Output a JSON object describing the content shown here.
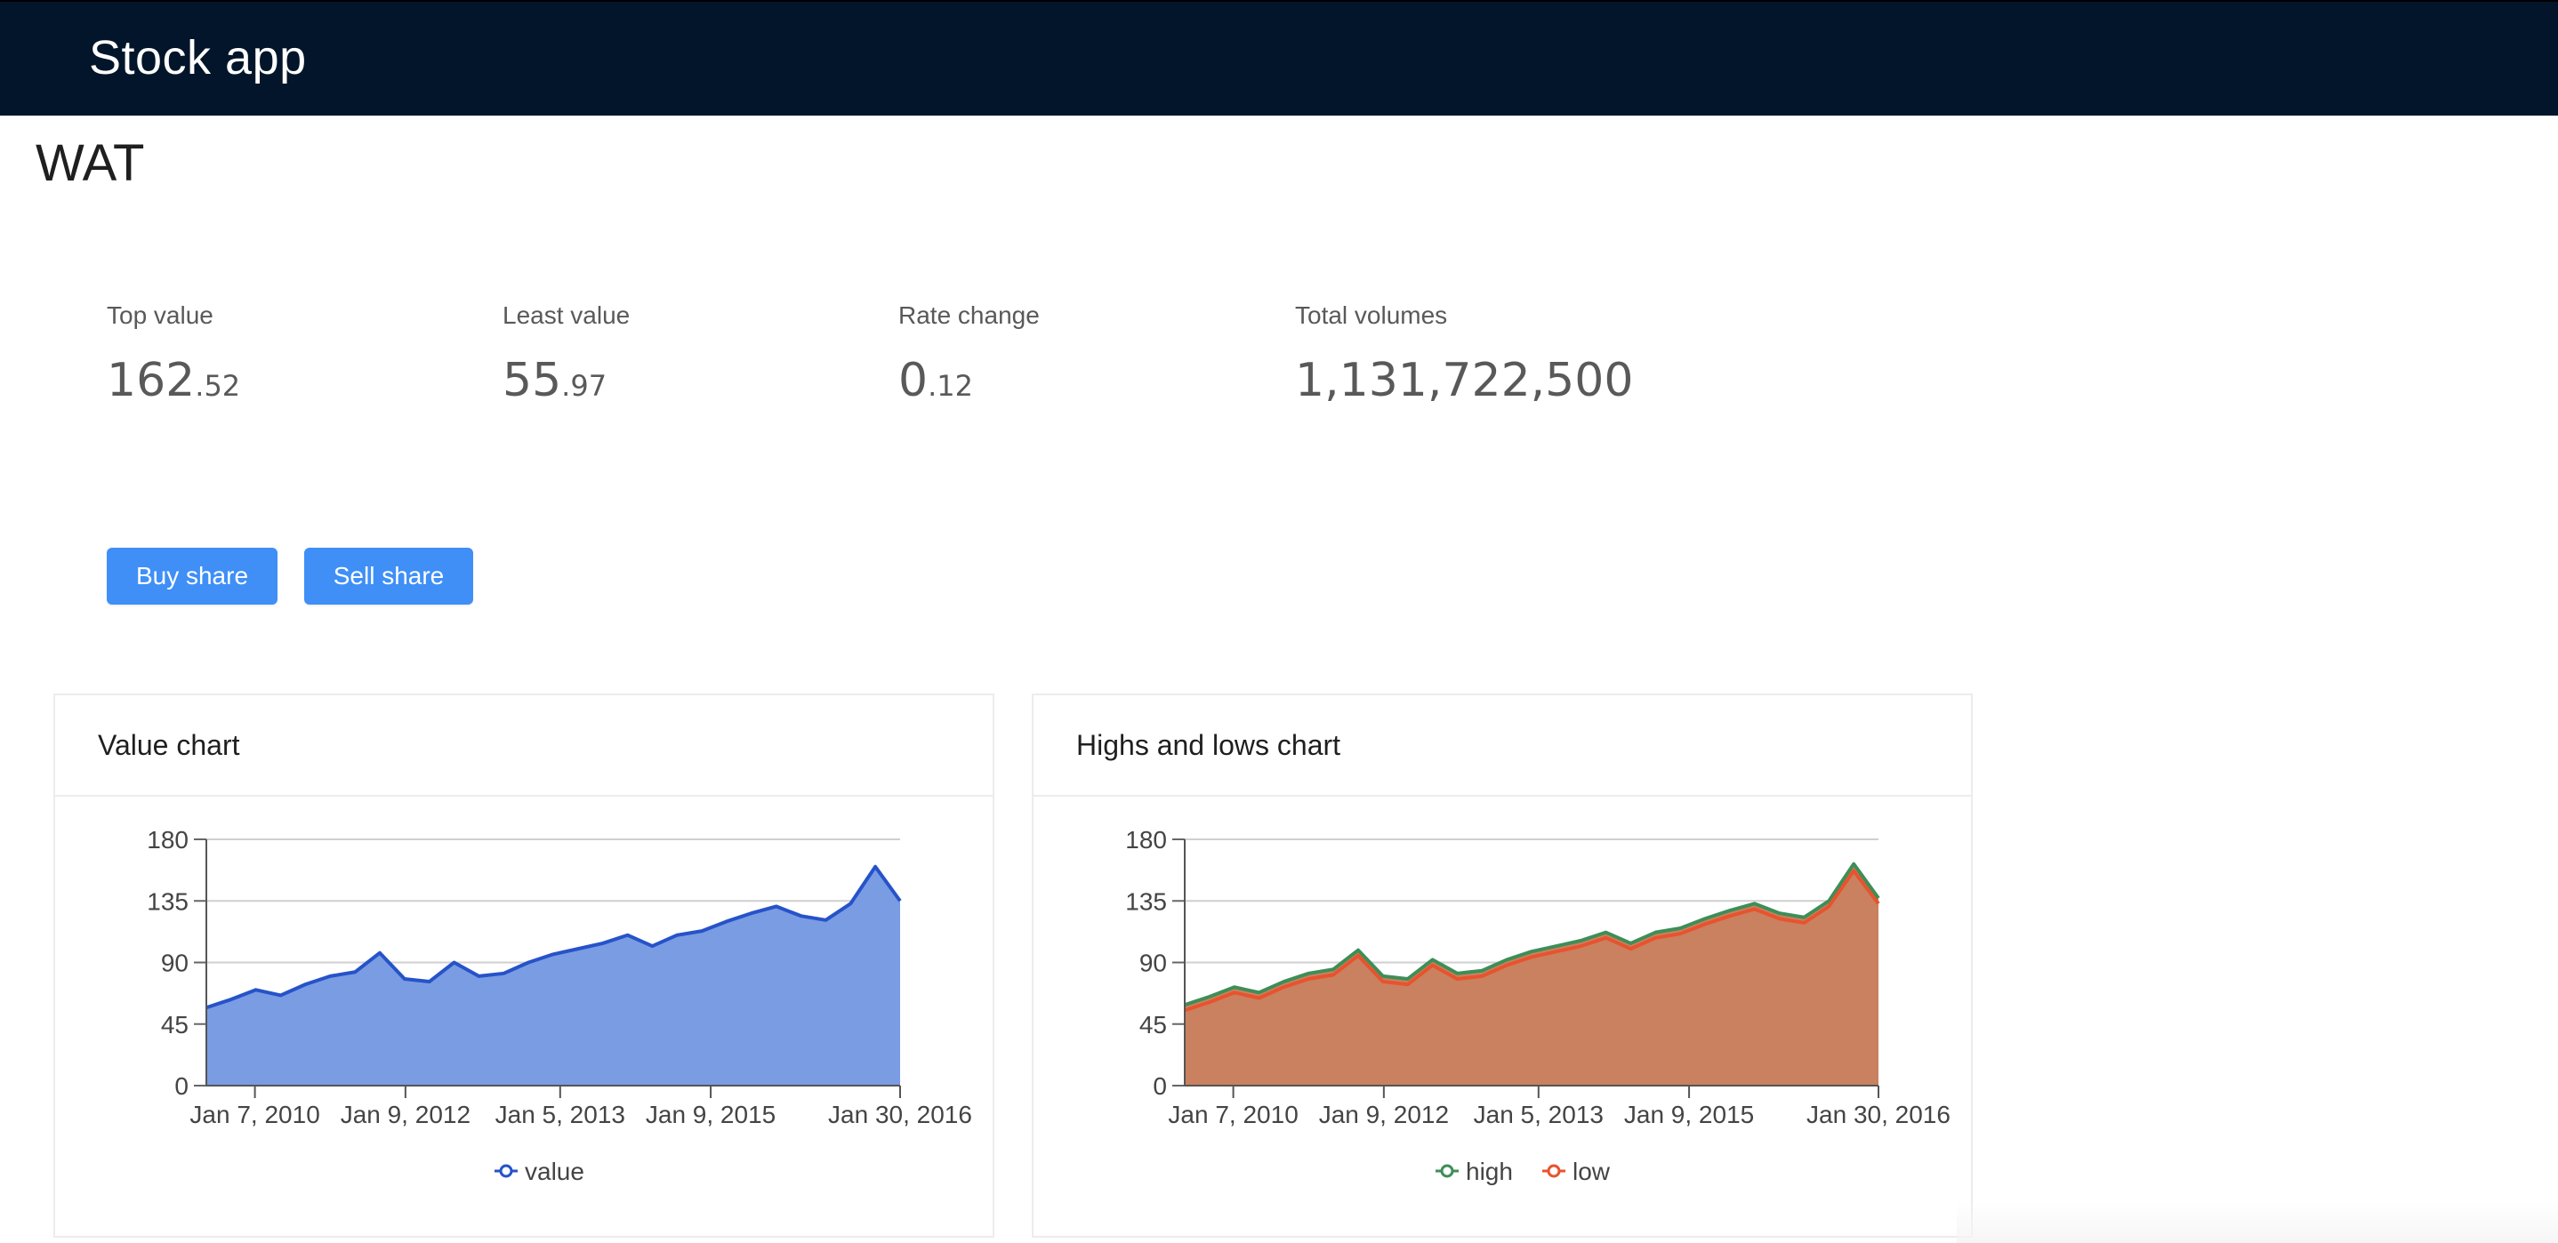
{
  "app": {
    "title": "Stock app"
  },
  "ticker": "WAT",
  "stats": [
    {
      "label": "Top value",
      "int": "162",
      "dec": ".52"
    },
    {
      "label": "Least value",
      "int": "55",
      "dec": ".97"
    },
    {
      "label": "Rate change",
      "int": "0",
      "dec": ".12"
    },
    {
      "label": "Total volumes",
      "int": "1,131,722,500",
      "dec": ""
    }
  ],
  "actions": {
    "buy_label": "Buy share",
    "sell_label": "Sell share"
  },
  "colors": {
    "navbar": "#03152a",
    "button": "#3f8ff7",
    "value_line": "#2653c9",
    "value_fill": "#7a9ce3",
    "high": "#3e8e57",
    "low": "#e8532e",
    "hl_fill": "#c98160"
  },
  "cards": {
    "value_title": "Value chart",
    "hl_title": "Highs and lows chart"
  },
  "chart_data": [
    {
      "type": "area",
      "title": "Value chart",
      "xlabel": "",
      "ylabel": "",
      "ylim": [
        0,
        180
      ],
      "y_ticks": [
        0,
        45,
        90,
        135,
        180
      ],
      "x_tick_labels": [
        "Jan 7, 2010",
        "Jan 9, 2012",
        "Jan 5, 2013",
        "Jan 9, 2015",
        "Jan 30, 2016"
      ],
      "grid": true,
      "legend": "bottom",
      "x": [
        "2010-01",
        "2010-04",
        "2010-07",
        "2010-10",
        "2011-01",
        "2011-04",
        "2011-07",
        "2011-10",
        "2012-01",
        "2012-04",
        "2012-07",
        "2012-10",
        "2013-01",
        "2013-04",
        "2013-07",
        "2013-10",
        "2014-01",
        "2014-04",
        "2014-07",
        "2014-10",
        "2015-01",
        "2015-04",
        "2015-07",
        "2015-10",
        "2016-01",
        "2016-04",
        "2016-07",
        "2016-10",
        "2017-01"
      ],
      "series": [
        {
          "name": "value",
          "values": [
            57,
            63,
            70,
            66,
            74,
            80,
            83,
            97,
            78,
            76,
            90,
            80,
            82,
            90,
            96,
            100,
            104,
            110,
            102,
            110,
            113,
            120,
            126,
            131,
            124,
            121,
            133,
            160,
            135
          ]
        }
      ]
    },
    {
      "type": "area",
      "title": "Highs and lows chart",
      "xlabel": "",
      "ylabel": "",
      "ylim": [
        0,
        180
      ],
      "y_ticks": [
        0,
        45,
        90,
        135,
        180
      ],
      "x_tick_labels": [
        "Jan 7, 2010",
        "Jan 9, 2012",
        "Jan 5, 2013",
        "Jan 9, 2015",
        "Jan 30, 2016"
      ],
      "grid": true,
      "legend": "bottom",
      "x": [
        "2010-01",
        "2010-04",
        "2010-07",
        "2010-10",
        "2011-01",
        "2011-04",
        "2011-07",
        "2011-10",
        "2012-01",
        "2012-04",
        "2012-07",
        "2012-10",
        "2013-01",
        "2013-04",
        "2013-07",
        "2013-10",
        "2014-01",
        "2014-04",
        "2014-07",
        "2014-10",
        "2015-01",
        "2015-04",
        "2015-07",
        "2015-10",
        "2016-01",
        "2016-04",
        "2016-07",
        "2016-10",
        "2017-01"
      ],
      "series": [
        {
          "name": "high",
          "values": [
            59,
            65,
            72,
            68,
            76,
            82,
            85,
            99,
            80,
            78,
            92,
            82,
            84,
            92,
            98,
            102,
            106,
            112,
            104,
            112,
            115,
            122,
            128,
            133,
            126,
            123,
            135,
            162,
            137
          ]
        },
        {
          "name": "low",
          "values": [
            55,
            61,
            68,
            64,
            72,
            78,
            81,
            95,
            76,
            74,
            88,
            78,
            80,
            88,
            94,
            98,
            102,
            108,
            100,
            108,
            111,
            118,
            124,
            129,
            122,
            119,
            131,
            157,
            133
          ]
        }
      ]
    }
  ]
}
